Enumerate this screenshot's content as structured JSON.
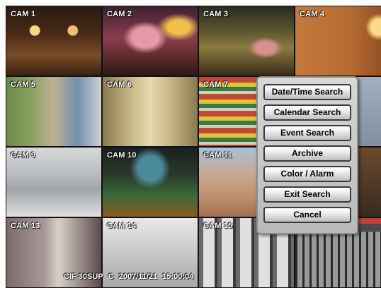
{
  "cameras": [
    {
      "label": "CAM 1"
    },
    {
      "label": "CAM 2"
    },
    {
      "label": "CAM 3"
    },
    {
      "label": "CAM 4"
    },
    {
      "label": "CAM 5"
    },
    {
      "label": "CAM 6"
    },
    {
      "label": "CAM 7"
    },
    {
      "label": ""
    },
    {
      "label": "CAM 9"
    },
    {
      "label": "CAM 10"
    },
    {
      "label": "CAM 11"
    },
    {
      "label": ""
    },
    {
      "label": "CAM 13"
    },
    {
      "label": "CAM 14"
    },
    {
      "label": "CAM 15"
    },
    {
      "label": ""
    }
  ],
  "status": {
    "resolution": "CIF 30SUP",
    "mode": "C",
    "date": "2007/11/21",
    "time": "15:00:04"
  },
  "search_menu": {
    "items": [
      "Date/Time Search",
      "Calendar Search",
      "Event Search",
      "Archive",
      "Color / Alarm",
      "Exit Search",
      "Cancel"
    ]
  }
}
